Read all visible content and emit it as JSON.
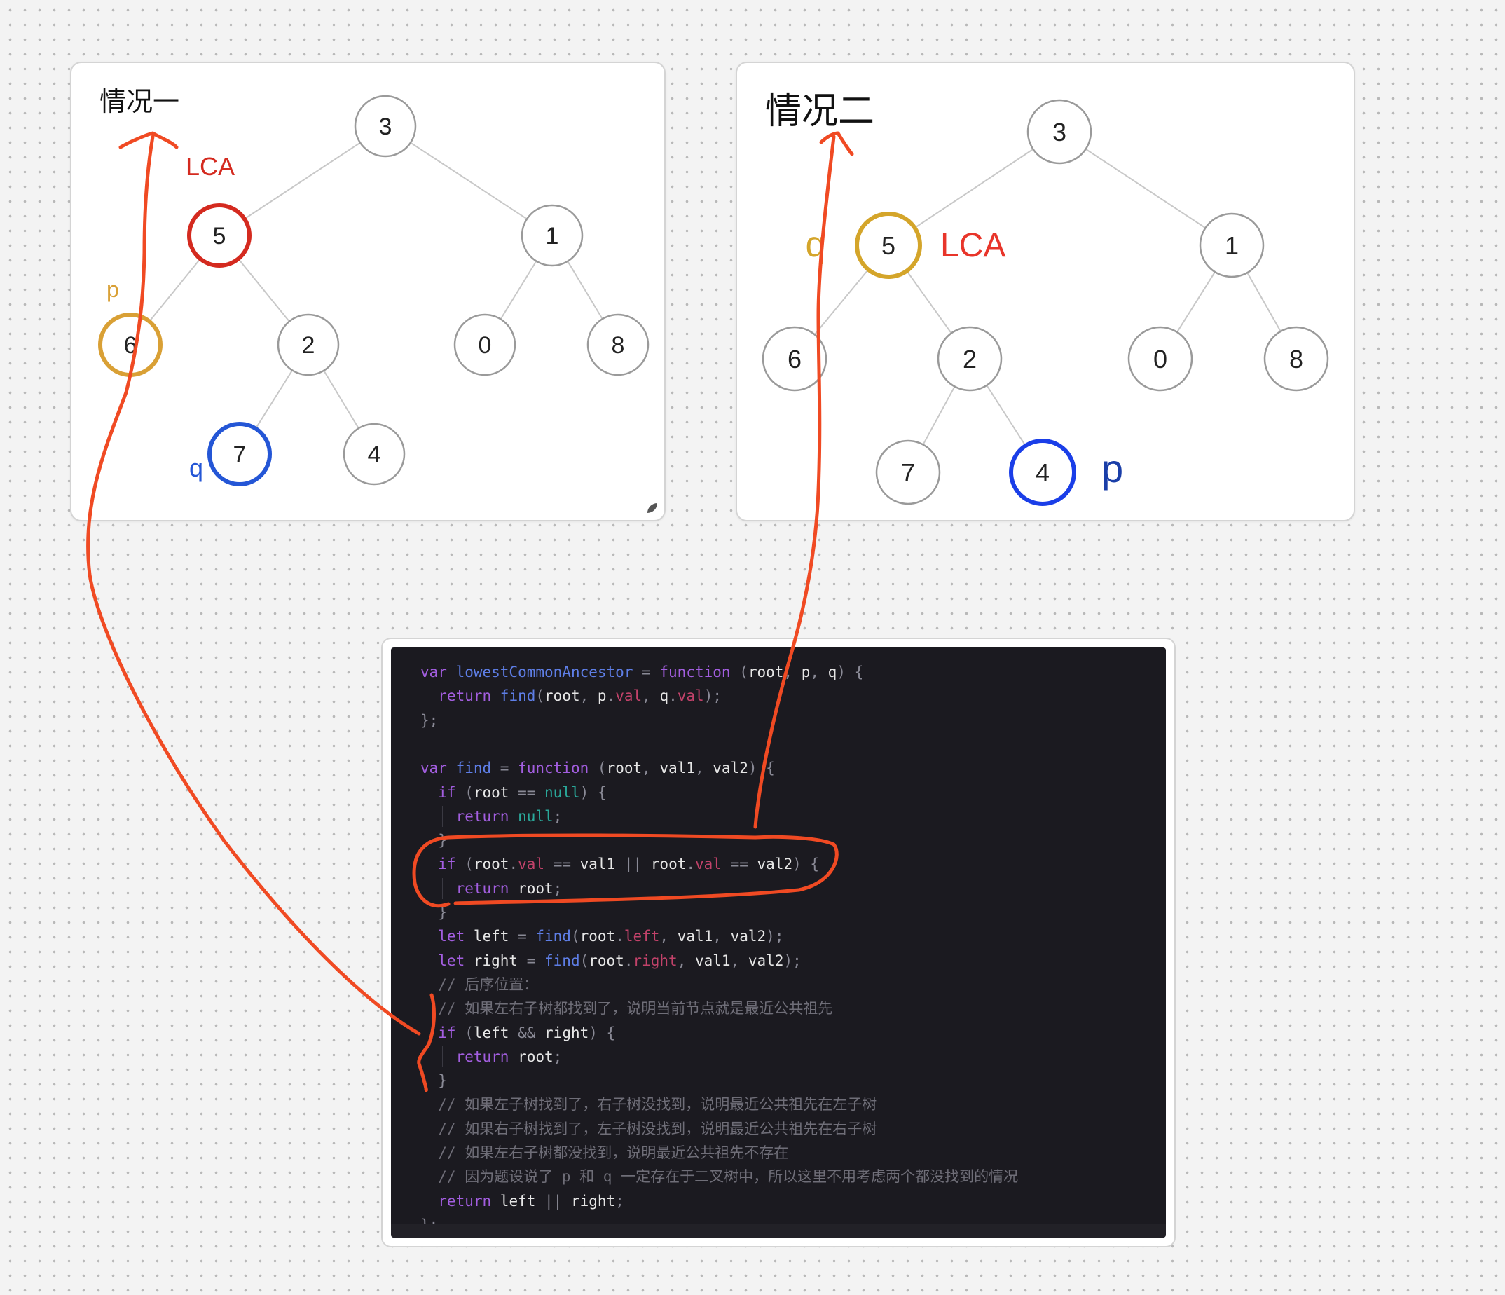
{
  "canvas": {
    "background": "dotted-grid"
  },
  "diagrams": [
    {
      "id": "case1",
      "title": "情况一",
      "tree": {
        "nodes": [
          {
            "id": "n3",
            "label": "3"
          },
          {
            "id": "n5",
            "label": "5",
            "highlight": "#d42a1f"
          },
          {
            "id": "n1",
            "label": "1"
          },
          {
            "id": "n6",
            "label": "6",
            "highlight": "#d9a035"
          },
          {
            "id": "n2",
            "label": "2"
          },
          {
            "id": "n0",
            "label": "0"
          },
          {
            "id": "n8",
            "label": "8"
          },
          {
            "id": "n7",
            "label": "7",
            "highlight": "#2456d6"
          },
          {
            "id": "n4",
            "label": "4"
          }
        ],
        "edges": [
          [
            "n3",
            "n5"
          ],
          [
            "n3",
            "n1"
          ],
          [
            "n5",
            "n6"
          ],
          [
            "n5",
            "n2"
          ],
          [
            "n1",
            "n0"
          ],
          [
            "n1",
            "n8"
          ],
          [
            "n2",
            "n7"
          ],
          [
            "n2",
            "n4"
          ]
        ]
      },
      "annotations": [
        {
          "text": "LCA",
          "target": "n5",
          "color": "#d42a1f"
        },
        {
          "text": "p",
          "target": "n6",
          "color": "#d9a035"
        },
        {
          "text": "q",
          "target": "n7",
          "color": "#2456d6"
        }
      ]
    },
    {
      "id": "case2",
      "title": "情况二",
      "tree": {
        "nodes": [
          {
            "id": "n3",
            "label": "3"
          },
          {
            "id": "n5",
            "label": "5",
            "highlight": "#d4a52a"
          },
          {
            "id": "n1",
            "label": "1"
          },
          {
            "id": "n6",
            "label": "6"
          },
          {
            "id": "n2",
            "label": "2"
          },
          {
            "id": "n0",
            "label": "0"
          },
          {
            "id": "n8",
            "label": "8"
          },
          {
            "id": "n7",
            "label": "7"
          },
          {
            "id": "n4",
            "label": "4",
            "highlight": "#1a3ee8"
          }
        ],
        "edges": [
          [
            "n3",
            "n5"
          ],
          [
            "n3",
            "n1"
          ],
          [
            "n5",
            "n6"
          ],
          [
            "n5",
            "n2"
          ],
          [
            "n1",
            "n0"
          ],
          [
            "n1",
            "n8"
          ],
          [
            "n2",
            "n7"
          ],
          [
            "n2",
            "n4"
          ]
        ]
      },
      "annotations": [
        {
          "text": "q",
          "target": "n5",
          "color": "#d4a52a"
        },
        {
          "text": "LCA",
          "target": "n5",
          "color": "#e8352a"
        },
        {
          "text": "p",
          "target": "n4",
          "color": "#1a3ea8"
        }
      ]
    }
  ],
  "code": {
    "language": "javascript",
    "lines": [
      [
        [
          "kw",
          "var "
        ],
        [
          "fn",
          "lowestCommonAncestor"
        ],
        [
          "pun",
          " = "
        ],
        [
          "kw",
          "function"
        ],
        [
          "pun",
          " ("
        ],
        [
          "id",
          "root"
        ],
        [
          "pun",
          ", "
        ],
        [
          "id",
          "p"
        ],
        [
          "pun",
          ", "
        ],
        [
          "id",
          "q"
        ],
        [
          "pun",
          ") {"
        ]
      ],
      [
        [
          "kw",
          "  return "
        ],
        [
          "fn",
          "find"
        ],
        [
          "pun",
          "("
        ],
        [
          "id",
          "root"
        ],
        [
          "pun",
          ", "
        ],
        [
          "id",
          "p"
        ],
        [
          "pun",
          "."
        ],
        [
          "prop",
          "val"
        ],
        [
          "pun",
          ", "
        ],
        [
          "id",
          "q"
        ],
        [
          "pun",
          "."
        ],
        [
          "prop",
          "val"
        ],
        [
          "pun",
          ");"
        ]
      ],
      [
        [
          "pun",
          "};"
        ]
      ],
      [],
      [
        [
          "kw",
          "var "
        ],
        [
          "fn",
          "find"
        ],
        [
          "pun",
          " = "
        ],
        [
          "kw",
          "function"
        ],
        [
          "pun",
          " ("
        ],
        [
          "id",
          "root"
        ],
        [
          "pun",
          ", "
        ],
        [
          "id",
          "val1"
        ],
        [
          "pun",
          ", "
        ],
        [
          "id",
          "val2"
        ],
        [
          "pun",
          ") {"
        ]
      ],
      [
        [
          "kw",
          "  if"
        ],
        [
          "pun",
          " ("
        ],
        [
          "id",
          "root"
        ],
        [
          "pun",
          " == "
        ],
        [
          "lit",
          "null"
        ],
        [
          "pun",
          ") {"
        ]
      ],
      [
        [
          "kw",
          "    return "
        ],
        [
          "lit",
          "null"
        ],
        [
          "pun",
          ";"
        ]
      ],
      [
        [
          "pun",
          "  }"
        ]
      ],
      [
        [
          "kw",
          "  if"
        ],
        [
          "pun",
          " ("
        ],
        [
          "id",
          "root"
        ],
        [
          "pun",
          "."
        ],
        [
          "prop",
          "val"
        ],
        [
          "pun",
          " == "
        ],
        [
          "id",
          "val1"
        ],
        [
          "pun",
          " || "
        ],
        [
          "id",
          "root"
        ],
        [
          "pun",
          "."
        ],
        [
          "prop",
          "val"
        ],
        [
          "pun",
          " == "
        ],
        [
          "id",
          "val2"
        ],
        [
          "pun",
          ") {"
        ]
      ],
      [
        [
          "kw",
          "    return "
        ],
        [
          "id",
          "root"
        ],
        [
          "pun",
          ";"
        ]
      ],
      [
        [
          "pun",
          "  }"
        ]
      ],
      [
        [
          "kw",
          "  let "
        ],
        [
          "id",
          "left"
        ],
        [
          "pun",
          " = "
        ],
        [
          "fn",
          "find"
        ],
        [
          "pun",
          "("
        ],
        [
          "id",
          "root"
        ],
        [
          "pun",
          "."
        ],
        [
          "prop",
          "left"
        ],
        [
          "pun",
          ", "
        ],
        [
          "id",
          "val1"
        ],
        [
          "pun",
          ", "
        ],
        [
          "id",
          "val2"
        ],
        [
          "pun",
          ");"
        ]
      ],
      [
        [
          "kw",
          "  let "
        ],
        [
          "id",
          "right"
        ],
        [
          "pun",
          " = "
        ],
        [
          "fn",
          "find"
        ],
        [
          "pun",
          "("
        ],
        [
          "id",
          "root"
        ],
        [
          "pun",
          "."
        ],
        [
          "prop",
          "right"
        ],
        [
          "pun",
          ", "
        ],
        [
          "id",
          "val1"
        ],
        [
          "pun",
          ", "
        ],
        [
          "id",
          "val2"
        ],
        [
          "pun",
          ");"
        ]
      ],
      [
        [
          "cm",
          "  // 后序位置："
        ]
      ],
      [
        [
          "cm",
          "  // 如果左右子树都找到了，说明当前节点就是最近公共祖先"
        ]
      ],
      [
        [
          "kw",
          "  if"
        ],
        [
          "pun",
          " ("
        ],
        [
          "id",
          "left"
        ],
        [
          "pun",
          " && "
        ],
        [
          "id",
          "right"
        ],
        [
          "pun",
          ") {"
        ]
      ],
      [
        [
          "kw",
          "    return "
        ],
        [
          "id",
          "root"
        ],
        [
          "pun",
          ";"
        ]
      ],
      [
        [
          "pun",
          "  }"
        ]
      ],
      [
        [
          "cm",
          "  // 如果左子树找到了，右子树没找到，说明最近公共祖先在左子树"
        ]
      ],
      [
        [
          "cm",
          "  // 如果右子树找到了，左子树没找到，说明最近公共祖先在右子树"
        ]
      ],
      [
        [
          "cm",
          "  // 如果左右子树都没找到，说明最近公共祖先不存在"
        ]
      ],
      [
        [
          "cm",
          "  // 因为题设说了 p 和 q 一定存在于二叉树中，所以这里不用考虑两个都没找到的情况"
        ]
      ],
      [
        [
          "kw",
          "  return "
        ],
        [
          "id",
          "left"
        ],
        [
          "pun",
          " || "
        ],
        [
          "id",
          "right"
        ],
        [
          "pun",
          ";"
        ]
      ],
      [
        [
          "pun",
          "};"
        ]
      ]
    ]
  },
  "ink": {
    "color": "#f04a23",
    "strokes": [
      "arrow from 'if (left && right)' block up to 情况一",
      "arrow from circled 'if (root.val == val1 || root.val == val2)' block up to 情况二",
      "circle around base-case return block",
      "brace beside 'if (left && right)' block"
    ]
  }
}
